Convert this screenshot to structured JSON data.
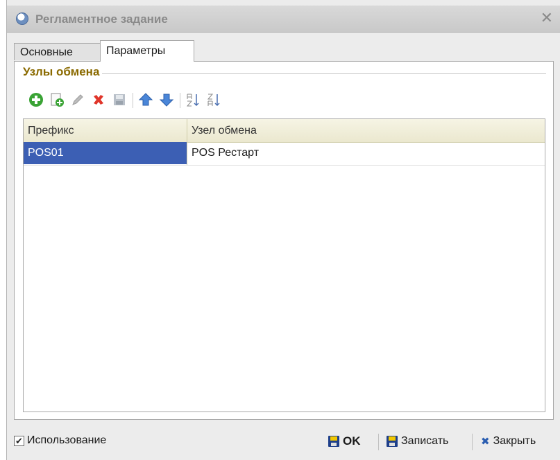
{
  "window": {
    "title": "Регламентное задание",
    "close_glyph": "✕"
  },
  "tabs": [
    {
      "label": "Основные",
      "active": false
    },
    {
      "label": "Параметры",
      "active": true
    }
  ],
  "group": {
    "title": "Узлы обмена"
  },
  "toolbar": {
    "icons": [
      "add-icon",
      "copy-icon",
      "edit-icon",
      "delete-icon",
      "save-icon",
      "move-up-icon",
      "move-down-icon",
      "sort-ascending-icon",
      "sort-descending-icon"
    ]
  },
  "table": {
    "columns": [
      "Префикс",
      "Узел обмена"
    ],
    "rows": [
      {
        "prefix": "POS01",
        "node": "POS Рестарт",
        "selected": true
      }
    ]
  },
  "footer": {
    "usage_checkbox": {
      "label": "Использование",
      "checked": true,
      "glyph": "✔"
    },
    "ok_label": "OK",
    "save_label": "Записать",
    "close_label": "Закрыть",
    "close_glyph": "✖"
  },
  "colors": {
    "selection": "#3c5fb4",
    "group_title": "#8a6a00",
    "header_bg": "#ebe8cf"
  }
}
